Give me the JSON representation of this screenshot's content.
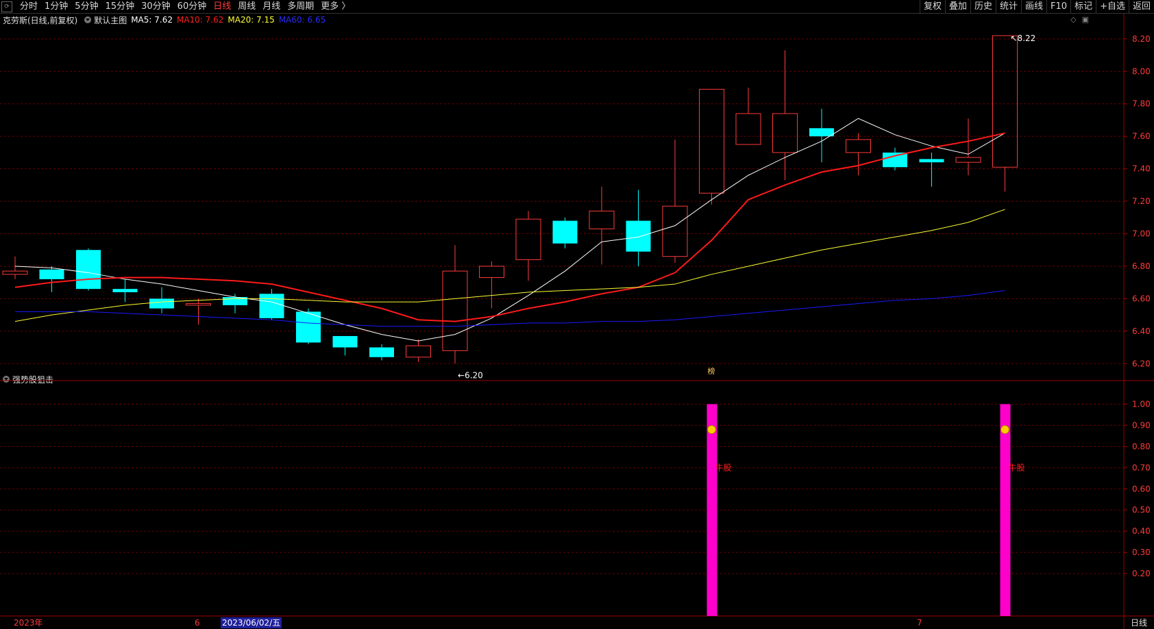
{
  "toolbar": {
    "periods": [
      "分时",
      "1分钟",
      "5分钟",
      "15分钟",
      "30分钟",
      "60分钟",
      "日线",
      "周线",
      "月线",
      "多周期",
      "更多 〉"
    ],
    "active_period": "日线",
    "right_buttons": [
      "复权",
      "叠加",
      "历史",
      "统计",
      "画线",
      "F10",
      "标记",
      "+自选",
      "返回"
    ]
  },
  "main_header": {
    "title": "克劳斯(日线,前复权)",
    "template": "默认主图",
    "ma5": "MA5: 7.62",
    "ma10": "MA10: 7.62",
    "ma20": "MA20: 7.15",
    "ma60": "MA60: 6.65"
  },
  "sub_header": {
    "title": "强势股狙击"
  },
  "annotations": {
    "low": "6.20",
    "high": "8.22",
    "marker": "榜",
    "signal_label": "牛股"
  },
  "bottom_axis": {
    "year": "2023年",
    "month6": "6",
    "cursor_date": "2023/06/02/五",
    "month7": "7",
    "period": "日线"
  },
  "colors": {
    "up": "#ff3b3b",
    "down": "#00ffff",
    "ma5": "#ffffff",
    "ma10": "#ff1a1a",
    "ma20": "#ffff33",
    "ma60": "#1a1aff",
    "signal": "#ff00cc",
    "grid": "#6b0000"
  },
  "chart_data": [
    {
      "type": "candlestick",
      "title": "克劳斯(日线,前复权)",
      "ylim": [
        6.1,
        8.25
      ],
      "y_ticks": [
        "8.20",
        "8.00",
        "7.80",
        "7.60",
        "7.40",
        "7.20",
        "7.00",
        "6.80",
        "6.60",
        "6.40",
        "6.20"
      ],
      "candles": [
        {
          "open": 6.75,
          "high": 6.86,
          "low": 6.72,
          "close": 6.77
        },
        {
          "open": 6.78,
          "high": 6.8,
          "low": 6.64,
          "close": 6.72
        },
        {
          "open": 6.9,
          "high": 6.91,
          "low": 6.65,
          "close": 6.66
        },
        {
          "open": 6.66,
          "high": 6.72,
          "low": 6.58,
          "close": 6.64
        },
        {
          "open": 6.6,
          "high": 6.67,
          "low": 6.51,
          "close": 6.54
        },
        {
          "open": 6.56,
          "high": 6.6,
          "low": 6.44,
          "close": 6.57
        },
        {
          "open": 6.61,
          "high": 6.63,
          "low": 6.51,
          "close": 6.56
        },
        {
          "open": 6.63,
          "high": 6.66,
          "low": 6.47,
          "close": 6.48
        },
        {
          "open": 6.52,
          "high": 6.54,
          "low": 6.32,
          "close": 6.33
        },
        {
          "open": 6.37,
          "high": 6.37,
          "low": 6.25,
          "close": 6.3
        },
        {
          "open": 6.3,
          "high": 6.32,
          "low": 6.22,
          "close": 6.24
        },
        {
          "open": 6.24,
          "high": 6.35,
          "low": 6.21,
          "close": 6.31
        },
        {
          "open": 6.28,
          "high": 6.93,
          "low": 6.2,
          "close": 6.77
        },
        {
          "open": 6.73,
          "high": 6.83,
          "low": 6.54,
          "close": 6.8
        },
        {
          "open": 6.84,
          "high": 7.14,
          "low": 6.71,
          "close": 7.09
        },
        {
          "open": 7.08,
          "high": 7.1,
          "low": 6.91,
          "close": 6.94
        },
        {
          "open": 7.03,
          "high": 7.29,
          "low": 6.81,
          "close": 7.14
        },
        {
          "open": 7.08,
          "high": 7.27,
          "low": 6.8,
          "close": 6.89
        },
        {
          "open": 6.86,
          "high": 7.58,
          "low": 6.82,
          "close": 7.17
        },
        {
          "open": 7.25,
          "high": 7.89,
          "low": 7.18,
          "close": 7.89
        },
        {
          "open": 7.55,
          "high": 7.9,
          "low": 7.55,
          "close": 7.74
        },
        {
          "open": 7.5,
          "high": 8.13,
          "low": 7.33,
          "close": 7.74
        },
        {
          "open": 7.65,
          "high": 7.77,
          "low": 7.44,
          "close": 7.6
        },
        {
          "open": 7.5,
          "high": 7.62,
          "low": 7.36,
          "close": 7.58
        },
        {
          "open": 7.5,
          "high": 7.53,
          "low": 7.39,
          "close": 7.41
        },
        {
          "open": 7.46,
          "high": 7.5,
          "low": 7.29,
          "close": 7.44
        },
        {
          "open": 7.44,
          "high": 7.71,
          "low": 7.36,
          "close": 7.47
        },
        {
          "open": 7.41,
          "high": 8.22,
          "low": 7.26,
          "close": 8.22
        }
      ],
      "series": [
        {
          "name": "MA5",
          "values": [
            6.8,
            6.79,
            6.76,
            6.72,
            6.69,
            6.65,
            6.61,
            6.58,
            6.51,
            6.44,
            6.38,
            6.34,
            6.38,
            6.48,
            6.62,
            6.77,
            6.95,
            6.98,
            7.05,
            7.21,
            7.36,
            7.47,
            7.57,
            7.71,
            7.61,
            7.54,
            7.49,
            7.62
          ]
        },
        {
          "name": "MA10",
          "values": [
            6.67,
            6.7,
            6.72,
            6.73,
            6.73,
            6.72,
            6.71,
            6.69,
            6.64,
            6.59,
            6.54,
            6.47,
            6.46,
            6.49,
            6.54,
            6.58,
            6.63,
            6.67,
            6.76,
            6.96,
            7.21,
            7.3,
            7.38,
            7.42,
            7.48,
            7.53,
            7.57,
            7.62
          ]
        },
        {
          "name": "MA20",
          "values": [
            6.46,
            6.5,
            6.53,
            6.56,
            6.58,
            6.59,
            6.6,
            6.6,
            6.59,
            6.58,
            6.58,
            6.58,
            6.6,
            6.62,
            6.64,
            6.65,
            6.66,
            6.67,
            6.69,
            6.75,
            6.8,
            6.85,
            6.9,
            6.94,
            6.98,
            7.02,
            7.07,
            7.15
          ]
        },
        {
          "name": "MA60",
          "values": [
            6.52,
            6.52,
            6.52,
            6.51,
            6.5,
            6.49,
            6.48,
            6.47,
            6.45,
            6.44,
            6.43,
            6.43,
            6.43,
            6.44,
            6.45,
            6.45,
            6.46,
            6.46,
            6.47,
            6.49,
            6.51,
            6.53,
            6.55,
            6.57,
            6.59,
            6.6,
            6.62,
            6.65
          ]
        }
      ]
    },
    {
      "type": "bar",
      "title": "强势股狙击",
      "ylim": [
        0,
        1.05
      ],
      "y_ticks": [
        "1.00",
        "0.90",
        "0.80",
        "0.70",
        "0.60",
        "0.50",
        "0.40",
        "0.30",
        "0.20"
      ],
      "signals": [
        {
          "index": 19,
          "value": 1.0
        },
        {
          "index": 27,
          "value": 1.0
        }
      ]
    }
  ]
}
